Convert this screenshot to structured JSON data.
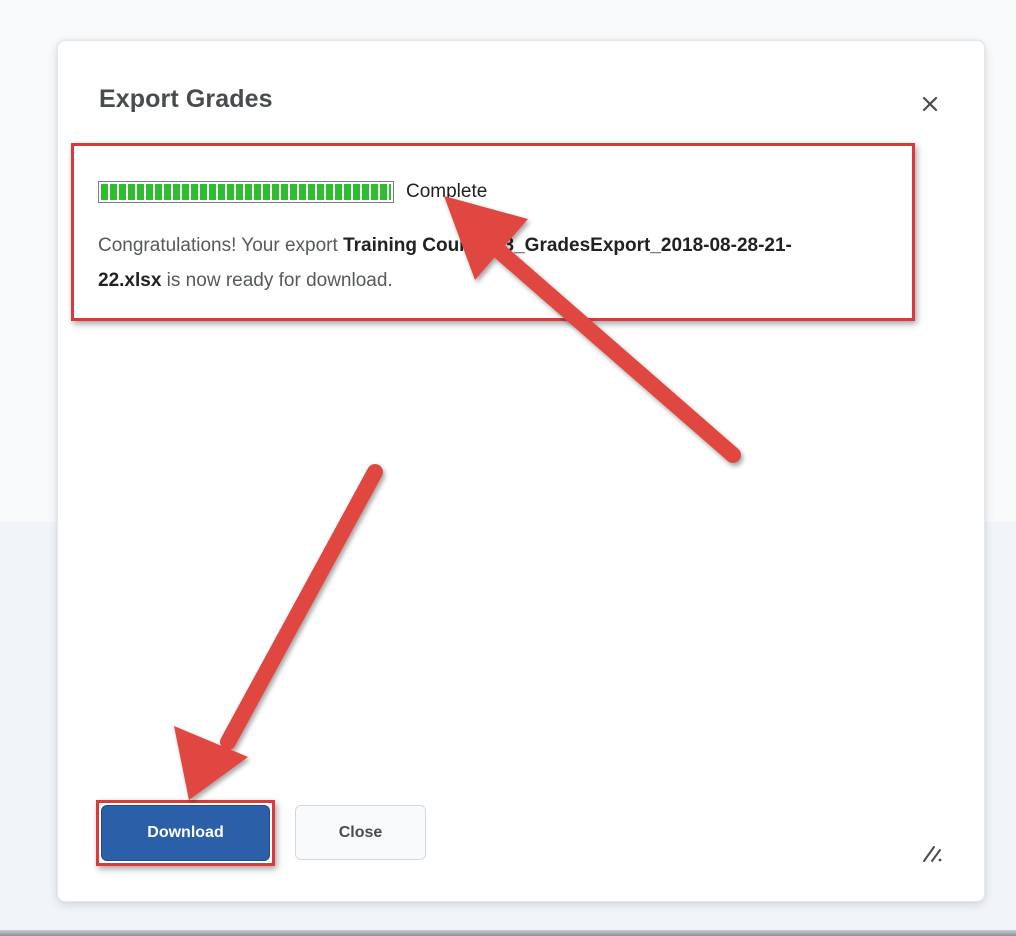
{
  "dialog": {
    "title": "Export Grades",
    "close_icon": "close-icon",
    "progress": {
      "percent": 100,
      "status_label": "Complete",
      "fill_color": "#2ebd2e"
    },
    "message": {
      "prefix": "Congratulations! Your export ",
      "filename_line1": "Training Course 03_GradesExport_2018-08-28-21-",
      "filename_line2": "22.xlsx",
      "suffix": " is now ready for download."
    },
    "buttons": {
      "download_label": "Download",
      "close_label": "Close"
    },
    "resize_icon": "resize-grip-icon"
  },
  "colors": {
    "primary_button": "#2b5fa8",
    "annotation_red": "#d93a3a",
    "title_text": "#494c4e"
  },
  "annotations": {
    "arrow_icon": "red-arrow-icon"
  }
}
